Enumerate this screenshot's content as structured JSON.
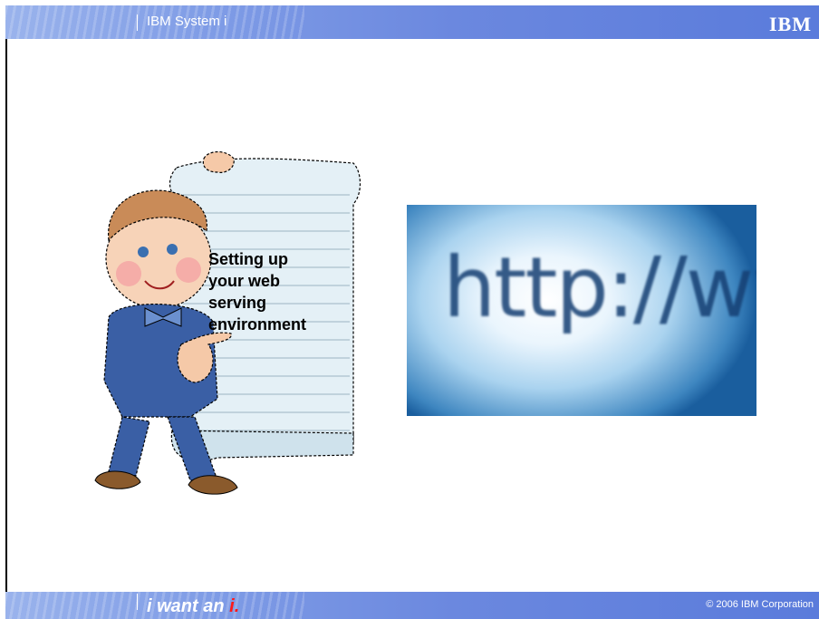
{
  "header": {
    "title": "IBM System i",
    "logo": "IBM"
  },
  "scroll": {
    "text": "Setting up\nyour web\nserving\nenvironment"
  },
  "image": {
    "url_text": "http://www"
  },
  "footer": {
    "tagline_main": "i want an ",
    "tagline_accent": "i",
    "tagline_end": ".",
    "copyright": "© 2006 IBM Corporation"
  },
  "colors": {
    "bar": "#6b88df",
    "accent": "#ff1a1a",
    "text": "#000000"
  }
}
